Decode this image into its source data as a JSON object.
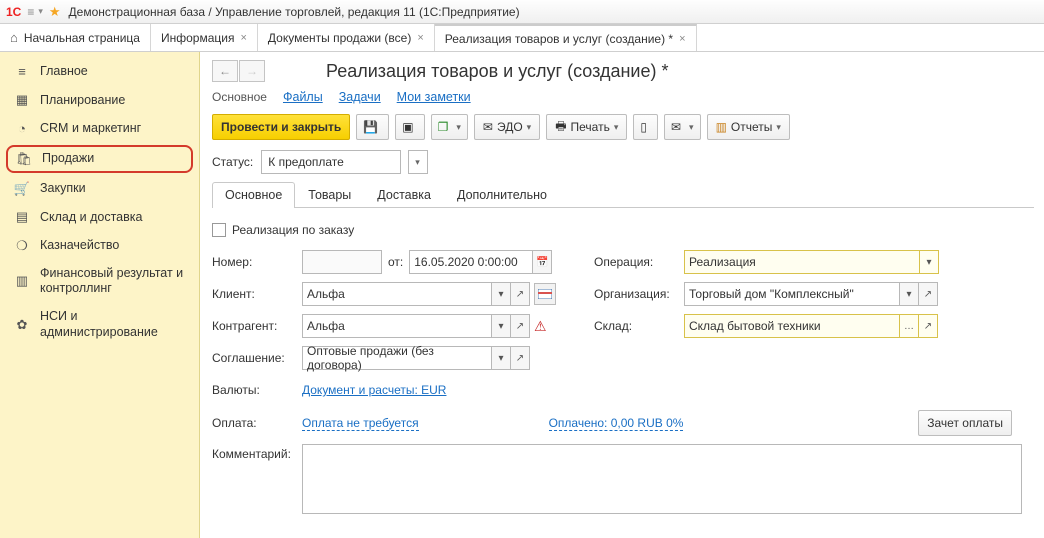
{
  "titlebar": {
    "logo": "1С",
    "title": "Демонстрационная база / Управление торговлей, редакция 11  (1С:Предприятие)"
  },
  "tabs": {
    "home": "Начальная страница",
    "t1": "Информация",
    "t2": "Документы продажи (все)",
    "t3": "Реализация товаров и услуг (создание) *"
  },
  "sidebar": {
    "main": "Главное",
    "planning": "Планирование",
    "crm": "CRM и маркетинг",
    "sales": "Продажи",
    "purchases": "Закупки",
    "warehouse": "Склад и доставка",
    "treasury": "Казначейство",
    "finres": "Финансовый результат и контроллинг",
    "nsi": "НСИ и администрирование"
  },
  "page": {
    "title": "Реализация товаров и услуг (создание) *"
  },
  "subtabs": {
    "main": "Основное",
    "files": "Файлы",
    "tasks": "Задачи",
    "notes": "Мои заметки"
  },
  "toolbar": {
    "post_close": "Провести и закрыть",
    "edo": "ЭДО",
    "print": "Печать",
    "reports": "Отчеты"
  },
  "status": {
    "label": "Статус:",
    "value": "К предоплате"
  },
  "formtabs": {
    "main": "Основное",
    "goods": "Товары",
    "delivery": "Доставка",
    "extra": "Дополнительно"
  },
  "form": {
    "by_order_label": "Реализация по заказу",
    "number_label": "Номер:",
    "date_label": "от:",
    "date_value": "16.05.2020  0:00:00",
    "operation_label": "Операция:",
    "operation_value": "Реализация",
    "client_label": "Клиент:",
    "client_value": "Альфа",
    "org_label": "Организация:",
    "org_value": "Торговый дом \"Комплексный\"",
    "counterparty_label": "Контрагент:",
    "counterparty_value": "Альфа",
    "warehouse_label": "Склад:",
    "warehouse_value": "Склад бытовой техники",
    "agreement_label": "Соглашение:",
    "agreement_value": "Оптовые продажи (без договора)",
    "currency_label": "Валюты:",
    "currency_link": "Документ и расчеты: EUR",
    "payment_label": "Оплата:",
    "payment_link1": "Оплата не требуется",
    "payment_link2": "Оплачено: 0,00 RUB  0%",
    "offset_btn": "Зачет оплаты",
    "comment_label": "Комментарий:"
  }
}
